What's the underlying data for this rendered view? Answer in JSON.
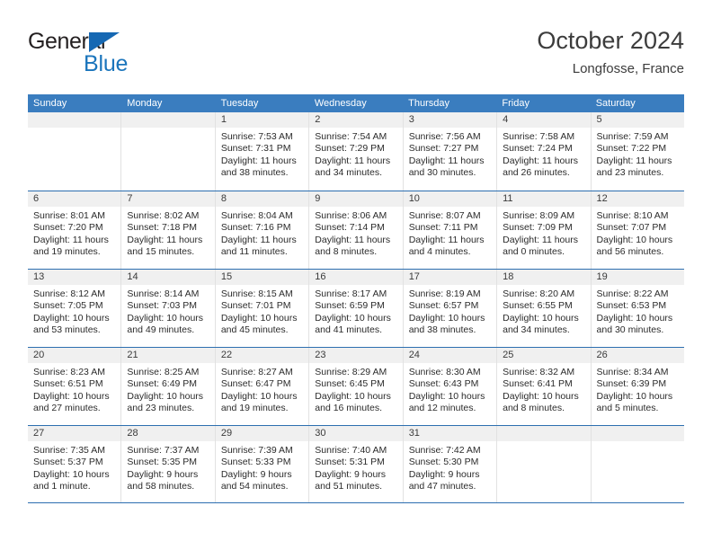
{
  "brand": {
    "name_top": "General",
    "name_bottom": "Blue"
  },
  "header": {
    "title": "October 2024",
    "subtitle": "Longfosse, France"
  },
  "colors": {
    "header_blue": "#3a7dbf",
    "row_rule_blue": "#2d6fb0",
    "daynum_band": "#f0f0f0",
    "brand_blue": "#1b75bc"
  },
  "weekdays": [
    "Sunday",
    "Monday",
    "Tuesday",
    "Wednesday",
    "Thursday",
    "Friday",
    "Saturday"
  ],
  "weeks": [
    [
      {
        "empty": true
      },
      {
        "empty": true
      },
      {
        "day": "1",
        "sunrise": "Sunrise: 7:53 AM",
        "sunset": "Sunset: 7:31 PM",
        "daylight": "Daylight: 11 hours and 38 minutes."
      },
      {
        "day": "2",
        "sunrise": "Sunrise: 7:54 AM",
        "sunset": "Sunset: 7:29 PM",
        "daylight": "Daylight: 11 hours and 34 minutes."
      },
      {
        "day": "3",
        "sunrise": "Sunrise: 7:56 AM",
        "sunset": "Sunset: 7:27 PM",
        "daylight": "Daylight: 11 hours and 30 minutes."
      },
      {
        "day": "4",
        "sunrise": "Sunrise: 7:58 AM",
        "sunset": "Sunset: 7:24 PM",
        "daylight": "Daylight: 11 hours and 26 minutes."
      },
      {
        "day": "5",
        "sunrise": "Sunrise: 7:59 AM",
        "sunset": "Sunset: 7:22 PM",
        "daylight": "Daylight: 11 hours and 23 minutes."
      }
    ],
    [
      {
        "day": "6",
        "sunrise": "Sunrise: 8:01 AM",
        "sunset": "Sunset: 7:20 PM",
        "daylight": "Daylight: 11 hours and 19 minutes."
      },
      {
        "day": "7",
        "sunrise": "Sunrise: 8:02 AM",
        "sunset": "Sunset: 7:18 PM",
        "daylight": "Daylight: 11 hours and 15 minutes."
      },
      {
        "day": "8",
        "sunrise": "Sunrise: 8:04 AM",
        "sunset": "Sunset: 7:16 PM",
        "daylight": "Daylight: 11 hours and 11 minutes."
      },
      {
        "day": "9",
        "sunrise": "Sunrise: 8:06 AM",
        "sunset": "Sunset: 7:14 PM",
        "daylight": "Daylight: 11 hours and 8 minutes."
      },
      {
        "day": "10",
        "sunrise": "Sunrise: 8:07 AM",
        "sunset": "Sunset: 7:11 PM",
        "daylight": "Daylight: 11 hours and 4 minutes."
      },
      {
        "day": "11",
        "sunrise": "Sunrise: 8:09 AM",
        "sunset": "Sunset: 7:09 PM",
        "daylight": "Daylight: 11 hours and 0 minutes."
      },
      {
        "day": "12",
        "sunrise": "Sunrise: 8:10 AM",
        "sunset": "Sunset: 7:07 PM",
        "daylight": "Daylight: 10 hours and 56 minutes."
      }
    ],
    [
      {
        "day": "13",
        "sunrise": "Sunrise: 8:12 AM",
        "sunset": "Sunset: 7:05 PM",
        "daylight": "Daylight: 10 hours and 53 minutes."
      },
      {
        "day": "14",
        "sunrise": "Sunrise: 8:14 AM",
        "sunset": "Sunset: 7:03 PM",
        "daylight": "Daylight: 10 hours and 49 minutes."
      },
      {
        "day": "15",
        "sunrise": "Sunrise: 8:15 AM",
        "sunset": "Sunset: 7:01 PM",
        "daylight": "Daylight: 10 hours and 45 minutes."
      },
      {
        "day": "16",
        "sunrise": "Sunrise: 8:17 AM",
        "sunset": "Sunset: 6:59 PM",
        "daylight": "Daylight: 10 hours and 41 minutes."
      },
      {
        "day": "17",
        "sunrise": "Sunrise: 8:19 AM",
        "sunset": "Sunset: 6:57 PM",
        "daylight": "Daylight: 10 hours and 38 minutes."
      },
      {
        "day": "18",
        "sunrise": "Sunrise: 8:20 AM",
        "sunset": "Sunset: 6:55 PM",
        "daylight": "Daylight: 10 hours and 34 minutes."
      },
      {
        "day": "19",
        "sunrise": "Sunrise: 8:22 AM",
        "sunset": "Sunset: 6:53 PM",
        "daylight": "Daylight: 10 hours and 30 minutes."
      }
    ],
    [
      {
        "day": "20",
        "sunrise": "Sunrise: 8:23 AM",
        "sunset": "Sunset: 6:51 PM",
        "daylight": "Daylight: 10 hours and 27 minutes."
      },
      {
        "day": "21",
        "sunrise": "Sunrise: 8:25 AM",
        "sunset": "Sunset: 6:49 PM",
        "daylight": "Daylight: 10 hours and 23 minutes."
      },
      {
        "day": "22",
        "sunrise": "Sunrise: 8:27 AM",
        "sunset": "Sunset: 6:47 PM",
        "daylight": "Daylight: 10 hours and 19 minutes."
      },
      {
        "day": "23",
        "sunrise": "Sunrise: 8:29 AM",
        "sunset": "Sunset: 6:45 PM",
        "daylight": "Daylight: 10 hours and 16 minutes."
      },
      {
        "day": "24",
        "sunrise": "Sunrise: 8:30 AM",
        "sunset": "Sunset: 6:43 PM",
        "daylight": "Daylight: 10 hours and 12 minutes."
      },
      {
        "day": "25",
        "sunrise": "Sunrise: 8:32 AM",
        "sunset": "Sunset: 6:41 PM",
        "daylight": "Daylight: 10 hours and 8 minutes."
      },
      {
        "day": "26",
        "sunrise": "Sunrise: 8:34 AM",
        "sunset": "Sunset: 6:39 PM",
        "daylight": "Daylight: 10 hours and 5 minutes."
      }
    ],
    [
      {
        "day": "27",
        "sunrise": "Sunrise: 7:35 AM",
        "sunset": "Sunset: 5:37 PM",
        "daylight": "Daylight: 10 hours and 1 minute."
      },
      {
        "day": "28",
        "sunrise": "Sunrise: 7:37 AM",
        "sunset": "Sunset: 5:35 PM",
        "daylight": "Daylight: 9 hours and 58 minutes."
      },
      {
        "day": "29",
        "sunrise": "Sunrise: 7:39 AM",
        "sunset": "Sunset: 5:33 PM",
        "daylight": "Daylight: 9 hours and 54 minutes."
      },
      {
        "day": "30",
        "sunrise": "Sunrise: 7:40 AM",
        "sunset": "Sunset: 5:31 PM",
        "daylight": "Daylight: 9 hours and 51 minutes."
      },
      {
        "day": "31",
        "sunrise": "Sunrise: 7:42 AM",
        "sunset": "Sunset: 5:30 PM",
        "daylight": "Daylight: 9 hours and 47 minutes."
      },
      {
        "empty": true
      },
      {
        "empty": true
      }
    ]
  ]
}
